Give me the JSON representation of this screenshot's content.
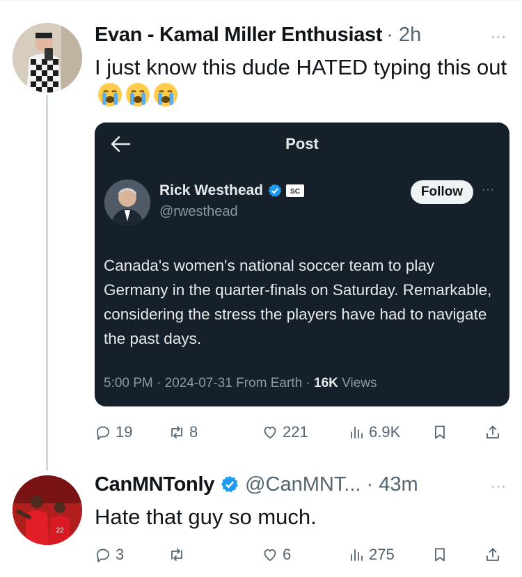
{
  "tweet1": {
    "author_name": "Evan - Kamal Miller Enthusiast",
    "time": "· 2h",
    "more": "···",
    "text": "I just know this dude HATED typing this out",
    "emoji_icon": "loudly-crying-face-icon",
    "stats": {
      "replies": "19",
      "retweets": "8",
      "likes": "221",
      "views": "6.9K"
    }
  },
  "embedded_post": {
    "title": "Post",
    "author_name": "Rick Westhead",
    "handle": "@rwesthead",
    "follow_label": "Follow",
    "more": "···",
    "text": "Canada's women's national soccer team to play Germany in the quarter-finals on Saturday. Remarkable, considering the stress the players have had to navigate the past days.",
    "meta_prefix": "5:00 PM · 2024-07-31 From Earth · ",
    "views_count": "16K",
    "views_label": " Views"
  },
  "tweet2": {
    "author_name": "CanMNTonly",
    "handle_time": "@CanMNT... · 43m",
    "more": "···",
    "text": "Hate that guy so much.",
    "stats": {
      "replies": "3",
      "retweets": "",
      "likes": "6",
      "views": "275"
    }
  },
  "colors": {
    "accent": "#1d9bf0",
    "card_bg": "#15202b",
    "muted": "#536471"
  }
}
